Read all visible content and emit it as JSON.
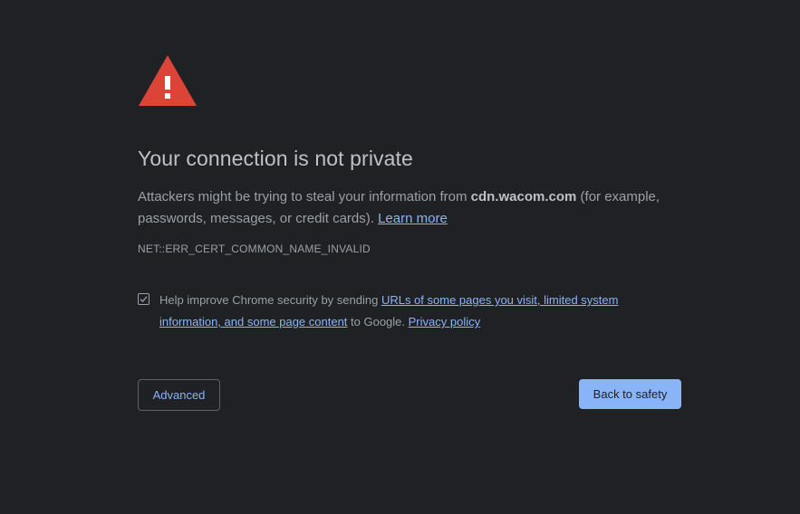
{
  "interstitial": {
    "icon": "warning-triangle-icon",
    "icon_color": "#db4437",
    "title": "Your connection is not private",
    "message": {
      "part1": "Attackers might be trying to steal your information from ",
      "domain": "cdn.wacom.com",
      "part2": " (for example, passwords, messages, or credit cards). ",
      "learn_more": "Learn more"
    },
    "error_code": "NET::ERR_CERT_COMMON_NAME_INVALID",
    "checkbox": {
      "checked": true,
      "text1": "Help improve Chrome security by sending ",
      "link1": "URLs of some pages you visit, limited system information, and some page content",
      "text2": " to Google. ",
      "link2": "Privacy policy"
    },
    "buttons": {
      "advanced": "Advanced",
      "back_to_safety": "Back to safety"
    }
  },
  "colors": {
    "background": "#202124",
    "link": "#8ab4f8",
    "primary_button": "#8ab4f8",
    "title_text": "#bdc1c6",
    "body_text": "#9aa0a6"
  }
}
